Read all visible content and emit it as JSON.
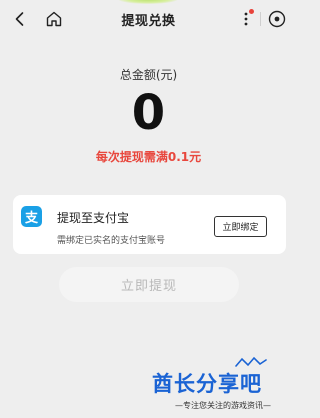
{
  "header": {
    "title": "提现兑换"
  },
  "balance": {
    "label": "总金额(元)",
    "amount": "0",
    "min_note": "每次提现需满0.1元"
  },
  "alipay_card": {
    "icon_glyph": "支",
    "title": "提现至支付宝",
    "subtitle": "需绑定已实名的支付宝账号",
    "bind_label": "立即绑定"
  },
  "withdraw": {
    "label": "立即提现"
  },
  "watermark": {
    "logo": "酋长分享吧",
    "tagline": "—专注您关注的游戏资讯—"
  },
  "colors": {
    "accent_red": "#e8473d",
    "alipay_blue": "#1aa0e6",
    "watermark_blue": "#1a63d4"
  }
}
